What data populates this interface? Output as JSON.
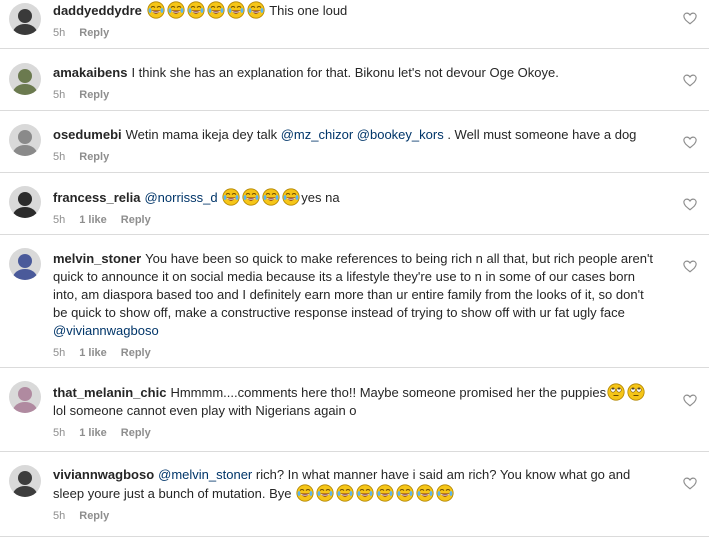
{
  "comments": [
    {
      "username": "daddyeddydre",
      "parts": [
        {
          "t": "e",
          "k": "laugh"
        },
        {
          "t": "e",
          "k": "laugh"
        },
        {
          "t": "e",
          "k": "laugh"
        },
        {
          "t": "e",
          "k": "laugh"
        },
        {
          "t": "e",
          "k": "laugh"
        },
        {
          "t": "e",
          "k": "laugh"
        },
        {
          "t": "s",
          "v": " This one loud"
        }
      ],
      "time": "5h",
      "likes": "",
      "reply": "Reply",
      "avatar_color": "#3a3a3a"
    },
    {
      "username": "amakaibens",
      "parts": [
        {
          "t": "s",
          "v": "I think she has an explanation for that. Bikonu let's not devour Oge Okoye."
        }
      ],
      "time": "5h",
      "likes": "",
      "reply": "Reply",
      "avatar_color": "#6b7a4f"
    },
    {
      "username": "osedumebi",
      "parts": [
        {
          "t": "s",
          "v": "Wetin mama ikeja dey talk "
        },
        {
          "t": "m",
          "v": "@mz_chizor"
        },
        {
          "t": "s",
          "v": " "
        },
        {
          "t": "m",
          "v": "@bookey_kors"
        },
        {
          "t": "s",
          "v": " . Well must someone have a dog"
        }
      ],
      "time": "5h",
      "likes": "",
      "reply": "Reply",
      "avatar_color": "#8a8a8a"
    },
    {
      "username": "francess_relia",
      "parts": [
        {
          "t": "m",
          "v": "@norrisss_d"
        },
        {
          "t": "s",
          "v": " "
        },
        {
          "t": "e",
          "k": "laugh"
        },
        {
          "t": "e",
          "k": "laugh"
        },
        {
          "t": "e",
          "k": "laugh"
        },
        {
          "t": "e",
          "k": "laugh"
        },
        {
          "t": "s",
          "v": "yes na"
        }
      ],
      "time": "5h",
      "likes": "1 like",
      "reply": "Reply",
      "avatar_color": "#2b2b2b"
    },
    {
      "username": "melvin_stoner",
      "parts": [
        {
          "t": "s",
          "v": "You have been so quick to make references to being rich n all that, but rich people aren't quick to announce it on social media because its a lifestyle they're use to n in some of our cases born into, am diaspora based too and I definitely earn more than ur entire family from the looks of it, so don't be quick to show off, make a constructive response instead of trying to show off with ur fat ugly face "
        },
        {
          "t": "m",
          "v": "@viviannwagboso"
        }
      ],
      "time": "5h",
      "likes": "1 like",
      "reply": "Reply",
      "avatar_color": "#4a5a9a"
    },
    {
      "username": "that_melanin_chic",
      "parts": [
        {
          "t": "s",
          "v": "Hmmmm....comments here tho!! Maybe someone promised her the puppies"
        },
        {
          "t": "e",
          "k": "roll"
        },
        {
          "t": "e",
          "k": "roll"
        },
        {
          "t": "s",
          "v": "lol someone cannot even play with Nigerians again o"
        }
      ],
      "time": "5h",
      "likes": "1 like",
      "reply": "Reply",
      "avatar_color": "#b08aa0"
    },
    {
      "username": "viviannwagboso",
      "parts": [
        {
          "t": "m",
          "v": "@melvin_stoner"
        },
        {
          "t": "s",
          "v": " rich? In what manner have i said am rich? You know what go and sleep youre just a bunch of mutation. Bye "
        },
        {
          "t": "e",
          "k": "laugh"
        },
        {
          "t": "e",
          "k": "laugh"
        },
        {
          "t": "e",
          "k": "laugh"
        },
        {
          "t": "e",
          "k": "laugh"
        },
        {
          "t": "e",
          "k": "laugh"
        },
        {
          "t": "e",
          "k": "laugh"
        },
        {
          "t": "e",
          "k": "laugh"
        },
        {
          "t": "e",
          "k": "laugh"
        }
      ],
      "time": "5h",
      "likes": "",
      "reply": "Reply",
      "avatar_color": "#3d3d3d"
    }
  ],
  "icons": {
    "like": "heart-outline-icon",
    "laugh": "face-with-tears-of-joy-icon",
    "roll": "face-with-rolling-eyes-icon"
  },
  "colors": {
    "mention": "#003569",
    "meta": "#8e8e8e",
    "divider": "#dbdbdb",
    "emoji": "#f5c518"
  }
}
